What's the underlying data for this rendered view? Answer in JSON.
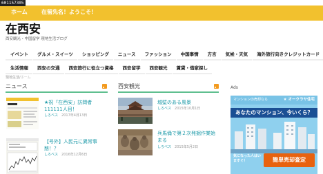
{
  "page_id": "601157305",
  "topbar": {
    "home": "ホーム",
    "welcome": "在留先名！ようこそ！"
  },
  "site": {
    "title": "在西安",
    "description": "西安観光・中国留学 現地生活ブログ"
  },
  "nav": {
    "row1": [
      "イベント",
      "グルメ・スイーツ",
      "ショッピング",
      "ニュース",
      "ファッション",
      "中国事情",
      "方言",
      "気候・天気",
      "海外旅行向きクレジットカード"
    ],
    "row2": [
      "生活情報",
      "西安の交通",
      "西安旅行に役立つ資格",
      "西安留学",
      "西安観光",
      "賃貸・借家探し"
    ]
  },
  "breadcrumb": {
    "home": "現地生活",
    "sep": "/",
    "here": "ホーム"
  },
  "news": {
    "heading": "ニュース",
    "posts": [
      {
        "title": "★祝「在西安」訪問者111111人目！",
        "author": "しろべス",
        "date": "2017年4月13日"
      },
      {
        "title": "【号外】人民元に異常事態！？",
        "author": "しろべス",
        "date": "2016年12月6日"
      }
    ]
  },
  "sightseeing": {
    "heading": "西安観光",
    "posts": [
      {
        "title": "城壁のある風景",
        "author": "しろべス",
        "date": "2015年10月1日"
      },
      {
        "title": "兵馬俑で第２次発掘作業始まる",
        "author": "しろべス",
        "date": "2015年5月2日"
      }
    ]
  },
  "ads": {
    "label": "Ads",
    "logo_left": "マンションの売却なら",
    "logo_right": "★ オークラヤ住宅",
    "headline": "あなたのマンション、今いくら？",
    "sub": "気になった人はいますぐ！",
    "cta": "簡単売却査定"
  },
  "colors": {
    "accent_yellow": "#f2c12e",
    "teal": "#1d9aa8",
    "rss_orange": "#f39a1e",
    "line_green": "#5fbf8f",
    "ad_blue": "#1a4f94",
    "ad_orange": "#e8620f"
  }
}
